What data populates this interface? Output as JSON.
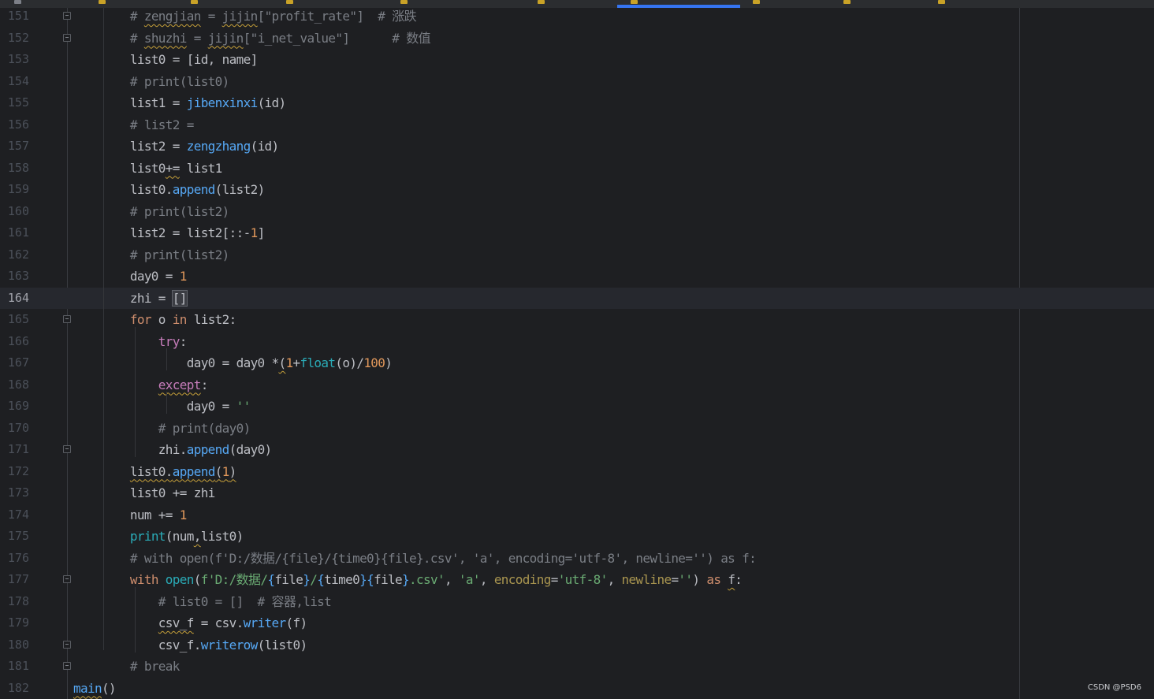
{
  "watermark": "CSDN @PSD6",
  "lines": [
    {
      "n": "151",
      "tokens": [
        {
          "t": "        "
        },
        {
          "t": "# ",
          "c": "cmt"
        },
        {
          "t": "zengjian",
          "c": "cmt squig"
        },
        {
          "t": " = ",
          "c": "cmt"
        },
        {
          "t": "jijin",
          "c": "cmt squig"
        },
        {
          "t": "[\"profit_rate\"]  # 涨跌",
          "c": "cmt"
        }
      ]
    },
    {
      "n": "152",
      "tokens": [
        {
          "t": "        "
        },
        {
          "t": "# ",
          "c": "cmt"
        },
        {
          "t": "shuzhi",
          "c": "cmt squig"
        },
        {
          "t": " = ",
          "c": "cmt"
        },
        {
          "t": "jijin",
          "c": "cmt squig"
        },
        {
          "t": "[\"i_net_value\"]      # 数值",
          "c": "cmt"
        }
      ]
    },
    {
      "n": "153",
      "tokens": [
        {
          "t": "        list0 = [id, name]"
        }
      ]
    },
    {
      "n": "154",
      "tokens": [
        {
          "t": "        "
        },
        {
          "t": "# print(list0)",
          "c": "cmt"
        }
      ]
    },
    {
      "n": "155",
      "tokens": [
        {
          "t": "        list1 = "
        },
        {
          "t": "jibenxinxi",
          "c": "fn"
        },
        {
          "t": "(id)"
        }
      ]
    },
    {
      "n": "156",
      "tokens": [
        {
          "t": "        "
        },
        {
          "t": "# list2 =",
          "c": "cmt"
        }
      ]
    },
    {
      "n": "157",
      "tokens": [
        {
          "t": "        list2 = "
        },
        {
          "t": "zengzhang",
          "c": "fn"
        },
        {
          "t": "(id)"
        }
      ]
    },
    {
      "n": "158",
      "tokens": [
        {
          "t": "        list0"
        },
        {
          "t": "+=",
          "c": "squig"
        },
        {
          "t": " list1"
        }
      ]
    },
    {
      "n": "159",
      "tokens": [
        {
          "t": "        list0."
        },
        {
          "t": "append",
          "c": "fn"
        },
        {
          "t": "(list2)"
        }
      ]
    },
    {
      "n": "160",
      "tokens": [
        {
          "t": "        "
        },
        {
          "t": "# print(list2)",
          "c": "cmt"
        }
      ]
    },
    {
      "n": "161",
      "tokens": [
        {
          "t": "        list2 = list2[::-"
        },
        {
          "t": "1",
          "c": "numo"
        },
        {
          "t": "]"
        }
      ]
    },
    {
      "n": "162",
      "tokens": [
        {
          "t": "        "
        },
        {
          "t": "# print(list2)",
          "c": "cmt"
        }
      ]
    },
    {
      "n": "163",
      "tokens": [
        {
          "t": "        day0 = "
        },
        {
          "t": "1",
          "c": "numo"
        }
      ]
    },
    {
      "n": "164",
      "current": true,
      "tokens": [
        {
          "t": "        zhi = "
        },
        {
          "t": "[]",
          "c": "caret-box"
        }
      ]
    },
    {
      "n": "165",
      "tokens": [
        {
          "t": "        "
        },
        {
          "t": "for",
          "c": "kw"
        },
        {
          "t": " o "
        },
        {
          "t": "in",
          "c": "kw"
        },
        {
          "t": " list2:"
        }
      ]
    },
    {
      "n": "166",
      "tokens": [
        {
          "t": "            "
        },
        {
          "t": "try",
          "c": "magenta"
        },
        {
          "t": ":"
        }
      ]
    },
    {
      "n": "167",
      "tokens": [
        {
          "t": "                day0 = day0 *"
        },
        {
          "t": "(",
          "c": "squig"
        },
        {
          "t": "1",
          "c": "numo"
        },
        {
          "t": "+"
        },
        {
          "t": "float",
          "c": "bi"
        },
        {
          "t": "(o)/"
        },
        {
          "t": "100",
          "c": "numo"
        },
        {
          "t": ")"
        }
      ]
    },
    {
      "n": "168",
      "tokens": [
        {
          "t": "            "
        },
        {
          "t": "except",
          "c": "magenta squig"
        },
        {
          "t": ":"
        }
      ]
    },
    {
      "n": "169",
      "tokens": [
        {
          "t": "                day0 = "
        },
        {
          "t": "''",
          "c": "str"
        }
      ]
    },
    {
      "n": "170",
      "tokens": [
        {
          "t": "            "
        },
        {
          "t": "# print(day0)",
          "c": "cmt"
        }
      ]
    },
    {
      "n": "171",
      "tokens": [
        {
          "t": "            zhi."
        },
        {
          "t": "append",
          "c": "fn"
        },
        {
          "t": "(day0)"
        }
      ]
    },
    {
      "n": "172",
      "tokens": [
        {
          "t": "        "
        },
        {
          "t": "list0.",
          "c": "squig"
        },
        {
          "t": "append",
          "c": "fn squig"
        },
        {
          "t": "(",
          "c": "squig"
        },
        {
          "t": "1",
          "c": "numo squig"
        },
        {
          "t": ")",
          "c": "squig"
        }
      ]
    },
    {
      "n": "173",
      "tokens": [
        {
          "t": "        list0 += zhi"
        }
      ]
    },
    {
      "n": "174",
      "tokens": [
        {
          "t": "        num += "
        },
        {
          "t": "1",
          "c": "numo"
        }
      ]
    },
    {
      "n": "175",
      "tokens": [
        {
          "t": "        "
        },
        {
          "t": "print",
          "c": "bi"
        },
        {
          "t": "(num"
        },
        {
          "t": ",",
          "c": "squig"
        },
        {
          "t": "list0)"
        }
      ]
    },
    {
      "n": "176",
      "tokens": [
        {
          "t": "        "
        },
        {
          "t": "# with open(f'D:/数据/{file}/{time0}{file}.csv', 'a', encoding='utf-8', newline='') as f:",
          "c": "cmt"
        }
      ]
    },
    {
      "n": "177",
      "tokens": [
        {
          "t": "        "
        },
        {
          "t": "with",
          "c": "kw"
        },
        {
          "t": " "
        },
        {
          "t": "open",
          "c": "bi"
        },
        {
          "t": "("
        },
        {
          "t": "f'D:/数据/",
          "c": "str"
        },
        {
          "t": "{",
          "c": "fn"
        },
        {
          "t": "file"
        },
        {
          "t": "}",
          "c": "fn"
        },
        {
          "t": "/",
          "c": "str"
        },
        {
          "t": "{",
          "c": "fn"
        },
        {
          "t": "time0"
        },
        {
          "t": "}{",
          "c": "fn"
        },
        {
          "t": "file"
        },
        {
          "t": "}",
          "c": "fn"
        },
        {
          "t": ".csv'",
          "c": "str"
        },
        {
          "t": ", "
        },
        {
          "t": "'a'",
          "c": "str"
        },
        {
          "t": ", "
        },
        {
          "t": "encoding",
          "c": "kwarg"
        },
        {
          "t": "="
        },
        {
          "t": "'utf-8'",
          "c": "str"
        },
        {
          "t": ", "
        },
        {
          "t": "newline",
          "c": "kwarg"
        },
        {
          "t": "="
        },
        {
          "t": "''",
          "c": "str"
        },
        {
          "t": ") "
        },
        {
          "t": "as",
          "c": "kw"
        },
        {
          "t": " "
        },
        {
          "t": "f",
          "c": "squig"
        },
        {
          "t": ":"
        }
      ]
    },
    {
      "n": "178",
      "tokens": [
        {
          "t": "            "
        },
        {
          "t": "# list0 = []  # 容器,list",
          "c": "cmt"
        }
      ]
    },
    {
      "n": "179",
      "tokens": [
        {
          "t": "            "
        },
        {
          "t": "csv_f",
          "c": "squig"
        },
        {
          "t": " = csv."
        },
        {
          "t": "writer",
          "c": "fn"
        },
        {
          "t": "(f)"
        }
      ]
    },
    {
      "n": "180",
      "tokens": [
        {
          "t": "            csv_f."
        },
        {
          "t": "writerow",
          "c": "fn"
        },
        {
          "t": "(list0)"
        }
      ]
    },
    {
      "n": "181",
      "tokens": [
        {
          "t": "        "
        },
        {
          "t": "# break",
          "c": "cmt"
        }
      ]
    },
    {
      "n": "182",
      "tokens": [
        {
          "t": "main",
          "c": "fn squig"
        },
        {
          "t": "()"
        }
      ]
    }
  ]
}
